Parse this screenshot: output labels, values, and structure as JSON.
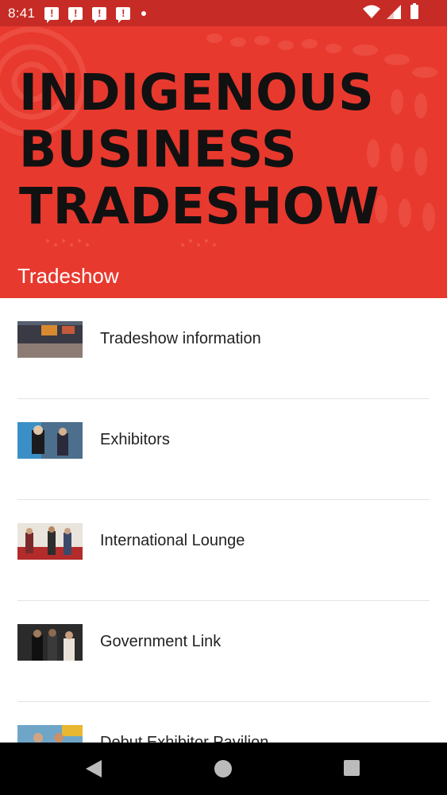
{
  "status_bar": {
    "time": "8:41",
    "notification_icons": [
      "alert-message-icon",
      "alert-message-icon",
      "alert-message-icon",
      "alert-message-icon"
    ],
    "indicators": [
      "wifi-icon",
      "signal-icon",
      "battery-icon"
    ]
  },
  "banner": {
    "title": "INDIGENOUS\nBUSINESS\nTRADESHOW",
    "section_title": "Tradeshow",
    "color": "#e8392e"
  },
  "list": {
    "items": [
      {
        "label": "Tradeshow information",
        "thumbnail": "tradeshow-hall-photo"
      },
      {
        "label": "Exhibitors",
        "thumbnail": "exhibitors-booth-photo"
      },
      {
        "label": "International Lounge",
        "thumbnail": "international-lounge-photo"
      },
      {
        "label": "Government Link",
        "thumbnail": "government-link-photo"
      },
      {
        "label": "Debut Exhibitor Pavilion",
        "thumbnail": "debut-exhibitor-photo"
      }
    ]
  },
  "nav_bar": {
    "buttons": [
      "back-icon",
      "home-icon",
      "recents-icon"
    ]
  },
  "colors": {
    "status_bar": "#c62b25",
    "banner": "#e8392e",
    "divider": "#e3e3e3"
  }
}
